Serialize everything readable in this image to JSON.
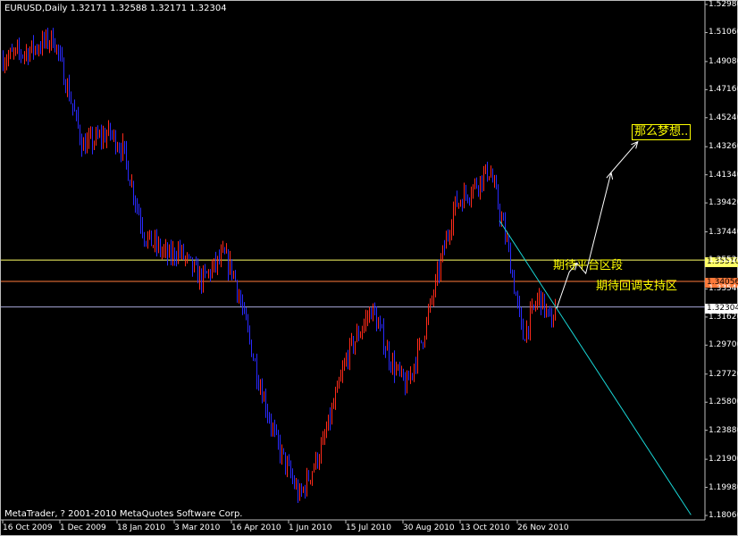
{
  "header": {
    "symbol_timeframe": "EURUSD,Daily",
    "open": "1.32171",
    "high": "1.32588",
    "low": "1.32171",
    "close": "1.32304"
  },
  "copyright": "MetaTrader, ? 2001-2010 MetaQuotes Software Corp.",
  "colors": {
    "background": "#000000",
    "bull_bar": "#ff2a1a",
    "bear_bar": "#2a2aff",
    "resistance_line": "#ffff66",
    "support_line": "#ff7a3a",
    "current_line": "#a8a8d8",
    "trendline": "#19d7d7",
    "arrow": "#ffffff",
    "annotation": "#ffff00"
  },
  "annotations": {
    "dream": "那么梦想..",
    "consolidation": "期待平台区段",
    "pullback": "期待回调支持区"
  },
  "price_tags": {
    "resistance": "1.35510",
    "support": "1.34056",
    "current": "1.32304"
  },
  "chart_data": {
    "type": "bar",
    "title": "EURUSD,Daily",
    "xlabel": "",
    "ylabel": "",
    "ylim": [
      1.1806,
      1.5298
    ],
    "y_ticks": [
      "1.52980",
      "1.51060",
      "1.49080",
      "1.47160",
      "1.45240",
      "1.43260",
      "1.41340",
      "1.39420",
      "1.37440",
      "1.35520",
      "1.33540",
      "1.31620",
      "1.29700",
      "1.27720",
      "1.25800",
      "1.23880",
      "1.21900",
      "1.19980",
      "1.18060"
    ],
    "x_ticks": [
      "16 Oct 2009",
      "1 Dec 2009",
      "18 Jan 2010",
      "3 Mar 2010",
      "16 Apr 2010",
      "1 Jun 2010",
      "15 Jul 2010",
      "30 Aug 2010",
      "13 Oct 2010",
      "26 Nov 2010"
    ],
    "horizontal_levels": [
      {
        "price": 1.3551,
        "color": "#ffff66"
      },
      {
        "price": 1.34056,
        "color": "#ff7a3a"
      },
      {
        "price": 1.32304,
        "color": "#a8a8d8"
      }
    ],
    "price_path": [
      [
        "16 Oct 2009",
        1.493
      ],
      [
        "5 Nov 2009",
        1.498
      ],
      [
        "25 Nov 2009",
        1.507
      ],
      [
        "8 Dec 2009",
        1.466
      ],
      [
        "18 Dec 2009",
        1.433
      ],
      [
        "8 Jan 2010",
        1.442
      ],
      [
        "18 Jan 2010",
        1.432
      ],
      [
        "5 Feb 2010",
        1.371
      ],
      [
        "24 Feb 2010",
        1.357
      ],
      [
        "3 Mar 2010",
        1.362
      ],
      [
        "22 Mar 2010",
        1.341
      ],
      [
        "8 Apr 2010",
        1.358
      ],
      [
        "16 Apr 2010",
        1.346
      ],
      [
        "5 May 2010",
        1.276
      ],
      [
        "19 May 2010",
        1.232
      ],
      [
        "7 Jun 2010",
        1.193
      ],
      [
        "25 Jun 2010",
        1.228
      ],
      [
        "15 Jul 2010",
        1.291
      ],
      [
        "3 Aug 2010",
        1.322
      ],
      [
        "18 Aug 2010",
        1.286
      ],
      [
        "30 Aug 2010",
        1.268
      ],
      [
        "13 Sep 2010",
        1.305
      ],
      [
        "7 Oct 2010",
        1.392
      ],
      [
        "4 Nov 2010",
        1.417
      ],
      [
        "18 Nov 2010",
        1.365
      ],
      [
        "30 Nov 2010",
        1.302
      ],
      [
        "13 Dec 2010",
        1.331
      ],
      [
        "22 Dec 2010",
        1.312
      ],
      [
        "27 Dec 2010",
        1.323
      ]
    ],
    "trendline": [
      [
        "12 Nov 2010",
        1.382
      ],
      [
        "12 Apr 2011",
        1.181
      ]
    ],
    "projection_path": [
      [
        "27 Dec 2010",
        1.322
      ],
      [
        "6 Jan 2011",
        1.347
      ],
      [
        "12 Jan 2011",
        1.353
      ],
      [
        "19 Jan 2011",
        1.346
      ],
      [
        "8 Feb 2011",
        1.415
      ],
      [
        "1 Mar 2011",
        1.436
      ]
    ],
    "last_close": 1.32304
  }
}
